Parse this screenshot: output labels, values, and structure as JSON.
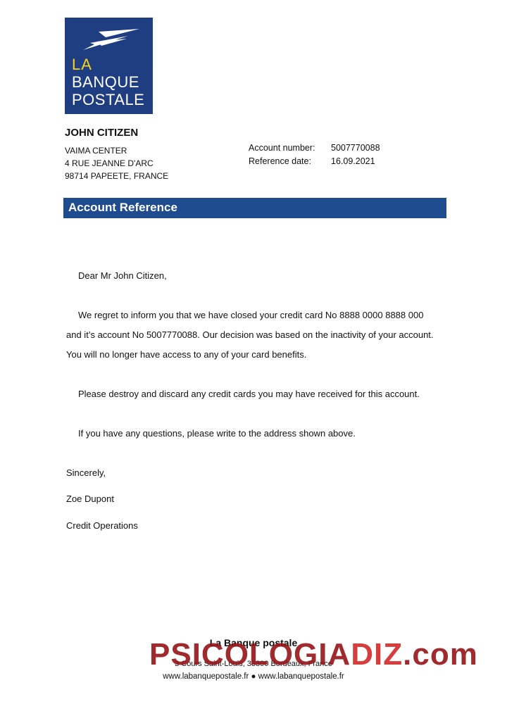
{
  "logo": {
    "line1": "LA",
    "line2": "BANQUE",
    "line3": "POSTALE"
  },
  "recipient": {
    "name": "JOHN CITIZEN",
    "address1": "VAIMA CENTER",
    "address2": "4 RUE JEANNE D'ARC",
    "address3": "98714 PAPEETE, FRANCE"
  },
  "meta": {
    "account_label": "Account number:",
    "account_value": "5007770088",
    "ref_label": "Reference date:",
    "ref_value": "16.09.2021"
  },
  "banner": "Account Reference",
  "letter": {
    "greeting": "Dear Mr John Citizen,",
    "p1_line1": "We regret to inform you that we have closed your credit card No 8888 0000 8888 000",
    "p1_line2": "and it’s account No 5007770088. Our decision was based on the inactivity of your account.",
    "p1_line3": "You will no longer have access to any of your card benefits.",
    "p2": "Please destroy and discard any credit cards you may have received for this account.",
    "p3": "If you have any questions, please write to the address shown above.",
    "closing": "Sincerely,",
    "signer": "Zoe Dupont",
    "dept": "Credit Operations"
  },
  "footer": {
    "company": "La Banque postale",
    "address": "3 Cours Saint-Louis, 33300 Bordeaux, France",
    "web": "www.labanquepostale.fr ● www.labanquepostale.fr"
  },
  "watermark": {
    "part1": "PSICOLOGIA",
    "part2": "DIZ",
    "part3": ".com"
  },
  "colors": {
    "brand_blue": "#1f3e82",
    "banner_blue": "#1f4b8f",
    "logo_yellow": "#f6d21c"
  }
}
